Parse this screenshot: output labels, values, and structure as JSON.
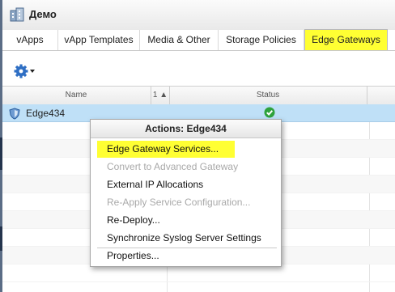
{
  "window": {
    "title": "Демо"
  },
  "tabs": [
    {
      "label": "vApps"
    },
    {
      "label": "vApp Templates"
    },
    {
      "label": "Media & Other"
    },
    {
      "label": "Storage Policies"
    },
    {
      "label": "Edge Gateways",
      "active": true
    }
  ],
  "toolbar": {
    "actions_icon": "gear-icon"
  },
  "grid": {
    "columns": {
      "name": "Name",
      "sort": "1 ▲",
      "status": "Status"
    },
    "rows": [
      {
        "name": "Edge434",
        "status_icon": "check-circle-icon",
        "selected": true
      }
    ]
  },
  "context_menu": {
    "title": "Actions: Edge434",
    "items": [
      {
        "label": "Edge Gateway Services...",
        "enabled": true,
        "highlighted": true
      },
      {
        "label": "Convert to Advanced Gateway",
        "enabled": false
      },
      {
        "label": "External IP Allocations",
        "enabled": true
      },
      {
        "label": "Re-Apply Service Configuration...",
        "enabled": false
      },
      {
        "label": "Re-Deploy...",
        "enabled": true
      },
      {
        "label": "Synchronize Syslog Server Settings",
        "enabled": true
      },
      {
        "label": "Properties...",
        "enabled": true
      }
    ]
  },
  "colors": {
    "highlight": "#ffff33",
    "selected_row": "#bfe0f7",
    "status_ok": "#2ea23c"
  }
}
